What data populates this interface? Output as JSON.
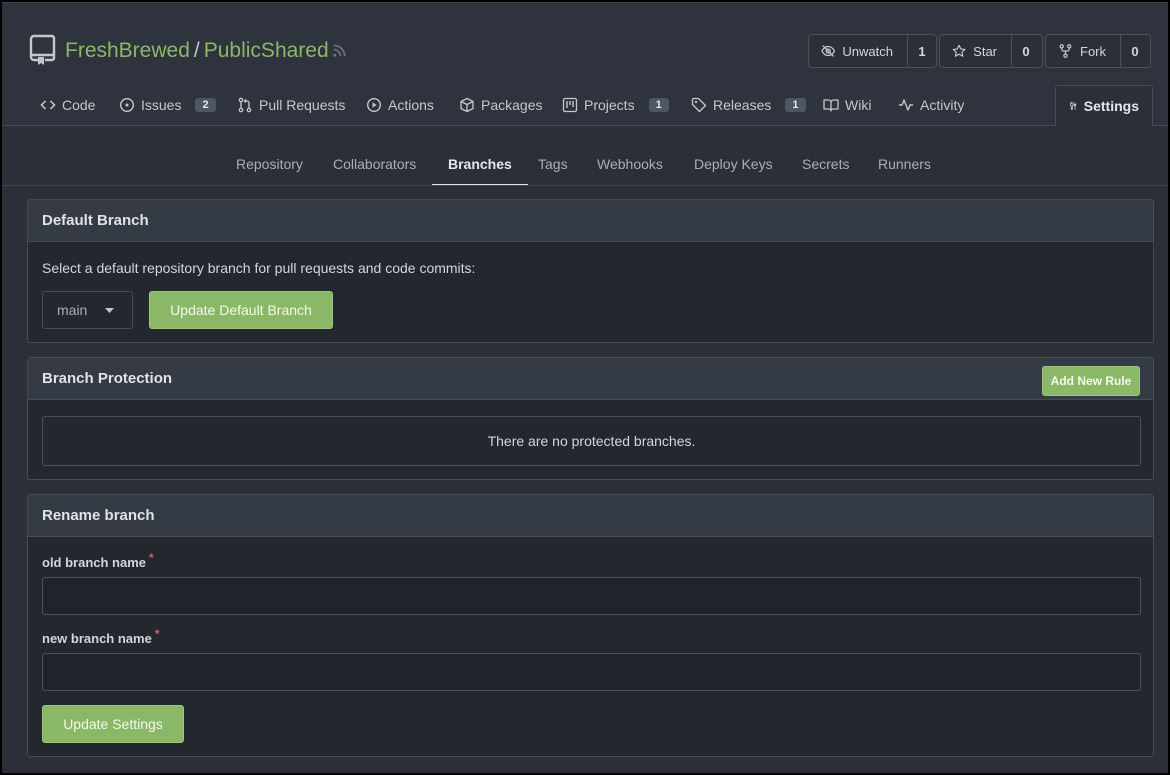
{
  "repo": {
    "owner": "FreshBrewed",
    "separator": "/",
    "name": "PublicShared"
  },
  "actions": {
    "watch": {
      "label": "Unwatch",
      "count": "1"
    },
    "star": {
      "label": "Star",
      "count": "0"
    },
    "fork": {
      "label": "Fork",
      "count": "0"
    }
  },
  "tabs": [
    {
      "label": "Code",
      "icon": "code-icon"
    },
    {
      "label": "Issues",
      "icon": "issue-icon",
      "badge": "2"
    },
    {
      "label": "Pull Requests",
      "icon": "pull-request-icon"
    },
    {
      "label": "Actions",
      "icon": "play-icon"
    },
    {
      "label": "Packages",
      "icon": "package-icon"
    },
    {
      "label": "Projects",
      "icon": "project-icon",
      "badge": "1"
    },
    {
      "label": "Releases",
      "icon": "tag-icon",
      "badge": "1"
    },
    {
      "label": "Wiki",
      "icon": "book-icon"
    },
    {
      "label": "Activity",
      "icon": "pulse-icon"
    },
    {
      "label": "Settings",
      "icon": "tools-icon",
      "active": true
    }
  ],
  "subnav": [
    "Repository",
    "Collaborators",
    "Branches",
    "Tags",
    "Webhooks",
    "Deploy Keys",
    "Secrets",
    "Runners"
  ],
  "subnav_active": "Branches",
  "default_branch": {
    "title": "Default Branch",
    "description": "Select a default repository branch for pull requests and code commits:",
    "selected": "main",
    "button": "Update Default Branch"
  },
  "protection": {
    "title": "Branch Protection",
    "add_button": "Add New Rule",
    "empty": "There are no protected branches."
  },
  "rename": {
    "title": "Rename branch",
    "old_label": "old branch name",
    "new_label": "new branch name",
    "required": "*",
    "old_value": "",
    "new_value": "",
    "button": "Update Settings"
  },
  "colors": {
    "accent": "#8bb866",
    "background": "#2b3038",
    "panel": "#23272e"
  }
}
